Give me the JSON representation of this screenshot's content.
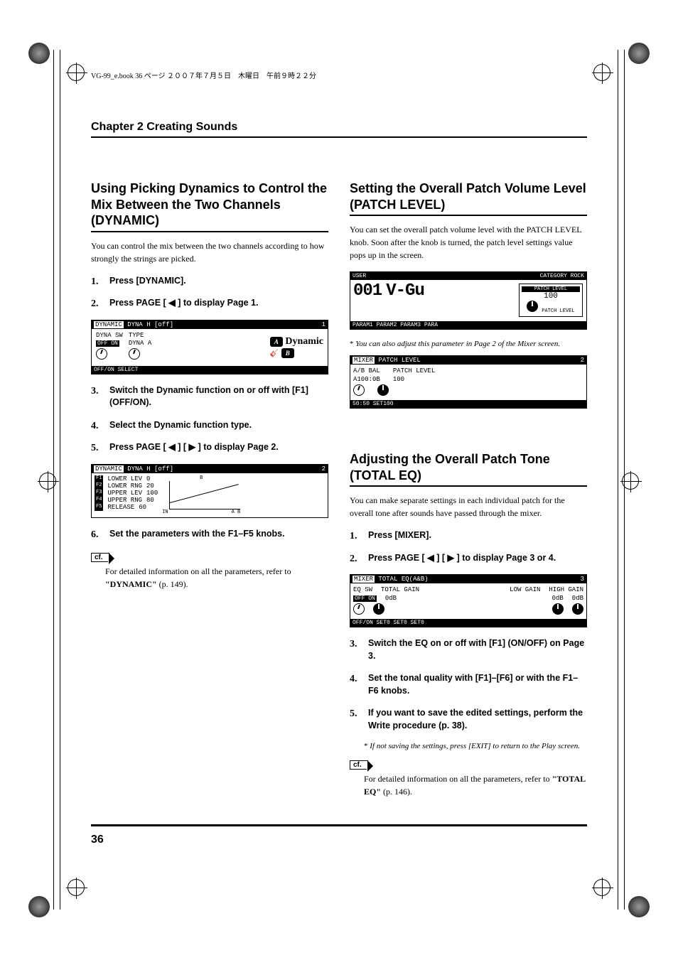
{
  "bookmeta": "VG-99_e.book 36 ページ ２００７年７月５日　木曜日　午前９時２２分",
  "chapter": "Chapter 2 Creating Sounds",
  "left": {
    "title": "Using Picking Dynamics to Control the Mix Between the Two Channels (DYNAMIC)",
    "intro": "You can control the mix between the two channels according to how strongly the strings are picked.",
    "steps": [
      "Press [DYNAMIC].",
      "Press PAGE [ ◀ ] to display Page 1.",
      "Switch the Dynamic function on or off with [F1] (OFF/ON).",
      "Select the Dynamic function type.",
      "Press PAGE [ ◀ ] [ ▶ ] to display Page 2.",
      "Set the parameters with the F1–F5 knobs."
    ],
    "screen1": {
      "header_l": "DYNAMIC",
      "header_r": "DYNA H [off]",
      "page": "1",
      "dyna_sw": "DYNA SW",
      "type": "TYPE",
      "off_on": "OFF ON",
      "dyna_a": "DYNA A",
      "footer": "OFF/ON SELECT",
      "label": "Dynamic",
      "badgeA": "A",
      "badgeB": "B"
    },
    "screen2": {
      "header_l": "DYNAMIC",
      "header_r": "DYNA H [off]",
      "page": "2",
      "rows": [
        {
          "fk": "F1",
          "name": "LOWER LEV",
          "val": "0"
        },
        {
          "fk": "F2",
          "name": "LOWER RNG",
          "val": "20"
        },
        {
          "fk": "F3",
          "name": "UPPER LEV",
          "val": "100"
        },
        {
          "fk": "F4",
          "name": "UPPER RNG",
          "val": "80"
        },
        {
          "fk": "F5",
          "name": "RELEASE",
          "val": "60"
        }
      ],
      "in_label": "IN",
      "ab": "A B",
      "bm": "B"
    },
    "cf_label": "cf.",
    "cf1_text": "For detailed information on all the parameters, refer to ",
    "cf1_ref": "\"DYNAMIC\"",
    "cf1_page": " (p. 149)."
  },
  "right": {
    "section1": {
      "title": "Setting the Overall Patch Volume Level (PATCH LEVEL)",
      "intro": "You can set the overall patch volume level with the PATCH LEVEL knob. Soon after the knob is turned, the patch level settings value pops up in the screen.",
      "screen_user": {
        "user": "USER",
        "cat": "CATEGORY ROCK",
        "num": "001",
        "name": "V-Gu",
        "popup_title": "PATCH LEVEL",
        "popup_val": "100",
        "popup_sub": "PATCH LEVEL",
        "footer": "PARAM1 PARAM2 PARAM3 PARA"
      },
      "note1": "You can also adjust this parameter in Page 2 of the Mixer screen.",
      "screen_mixer": {
        "header": "MIXER",
        "sub": "PATCH LEVEL",
        "page": "2",
        "ab_bal": "A/B BAL",
        "patch_lv": "PATCH LEVEL",
        "val1": "A100:0B",
        "val2": "100",
        "footer": "50:50 SET100"
      }
    },
    "section2": {
      "title": "Adjusting the Overall Patch Tone (TOTAL EQ)",
      "intro": "You can make separate settings in each individual patch for the overall tone after sounds have passed through the mixer.",
      "steps": [
        "Press [MIXER].",
        "Press PAGE [ ◀ ] [ ▶ ] to display Page 3 or 4.",
        "Switch the EQ on or off with [F1] (ON/OFF) on Page 3.",
        "Set the tonal quality with [F1]–[F6] or with the F1–F6 knobs.",
        "If you want to save the edited settings, perform the Write procedure (p. 38)."
      ],
      "screen_eq": {
        "header": "MIXER",
        "sub": "TOTAL EQ(A&B)",
        "page": "3",
        "eq_sw": "EQ SW",
        "total_gain": "TOTAL GAIN",
        "low_gain": "LOW GAIN",
        "high_gain": "HIGH GAIN",
        "off_on": "OFF ON",
        "val": "0dB",
        "footer": "OFF/ON  SET0            SET0   SET0"
      },
      "note1": "If not saving the settings, press [EXIT] to return to the Play screen.",
      "cf_text": "For detailed information on all the parameters, refer to ",
      "cf_ref": "\"TOTAL EQ\"",
      "cf_page": " (p. 146)."
    }
  },
  "page_number": "36"
}
